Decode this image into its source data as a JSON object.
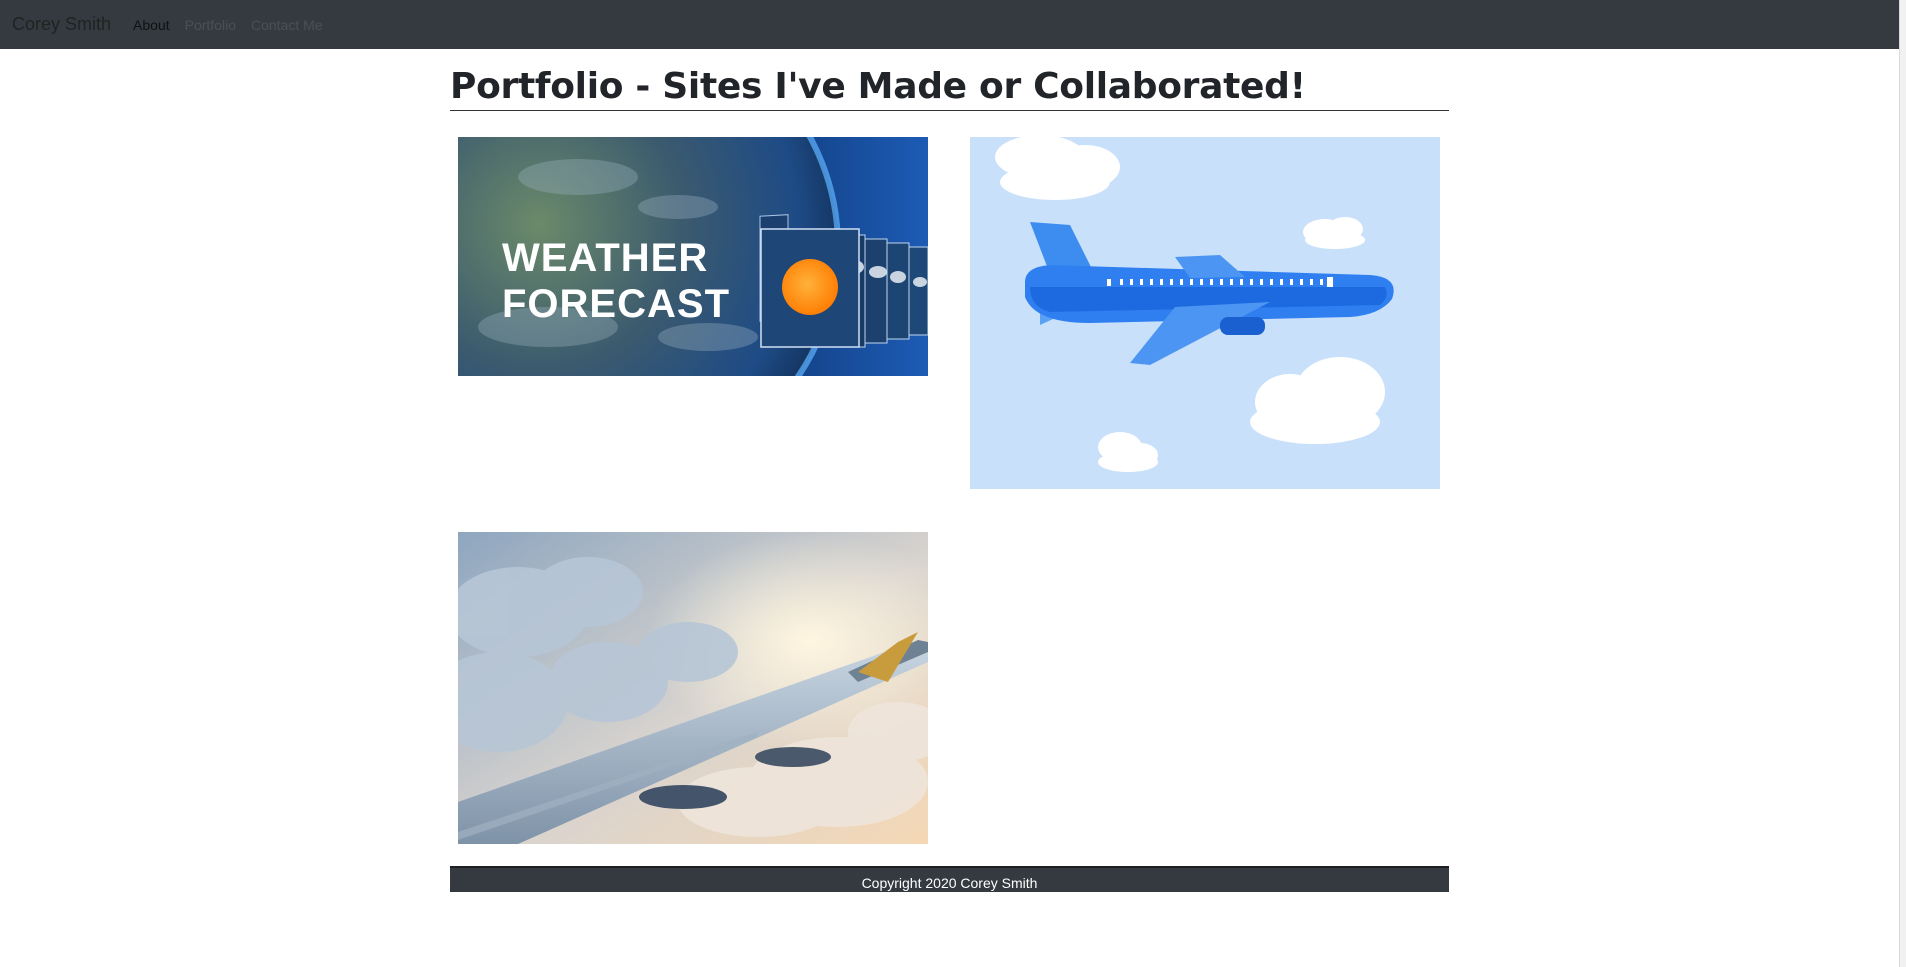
{
  "nav": {
    "brand": "Corey Smith",
    "links": [
      {
        "label": "About"
      },
      {
        "label": "Portfolio"
      },
      {
        "label": "Contact Me"
      }
    ]
  },
  "main": {
    "title": "Portfolio - Sites I've Made or Collaborated!",
    "projects": [
      {
        "image_text_line1": "WEATHER",
        "image_text_line2": "FORECAST"
      },
      {},
      {}
    ]
  },
  "footer": {
    "text": "Copyright 2020 Corey Smith"
  },
  "colors": {
    "navbar": "#343a40",
    "footer": "#343a40",
    "title": "#212529"
  }
}
